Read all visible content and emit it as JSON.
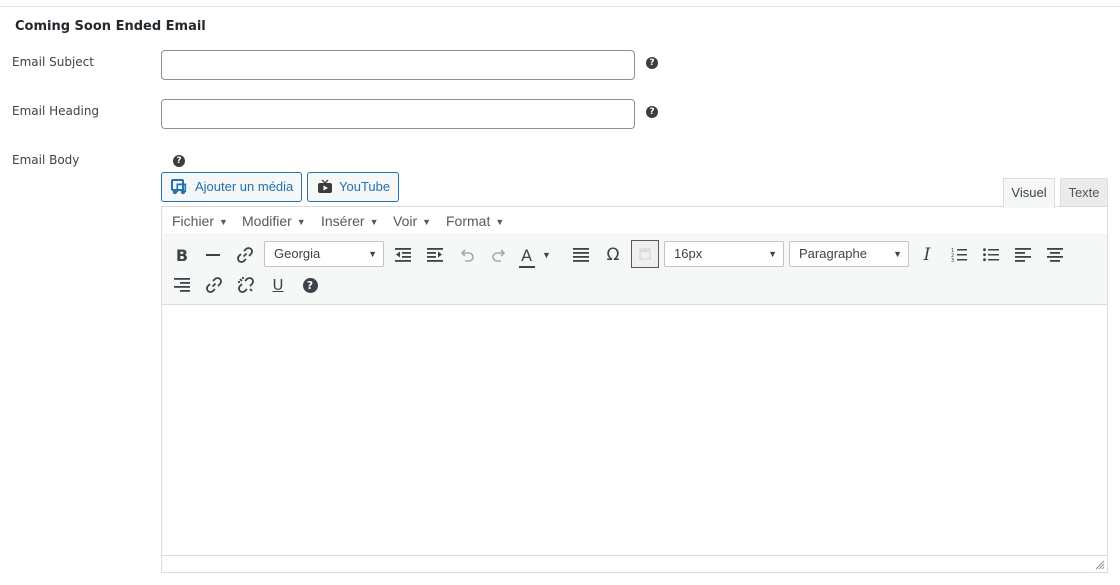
{
  "section": {
    "title": "Coming Soon Ended Email"
  },
  "fields": {
    "subject": {
      "label": "Email Subject",
      "value": "",
      "help": "?"
    },
    "heading": {
      "label": "Email Heading",
      "value": "",
      "help": "?"
    },
    "body": {
      "label": "Email Body",
      "help": "?"
    }
  },
  "media_buttons": {
    "add_media": "Ajouter un média",
    "youtube": "YouTube"
  },
  "editor_tabs": {
    "visual": "Visuel",
    "text": "Texte"
  },
  "menubar": {
    "file": "Fichier",
    "edit": "Modifier",
    "insert": "Insérer",
    "view": "Voir",
    "format": "Format"
  },
  "toolbar": {
    "font_family": "Georgia",
    "font_size": "16px",
    "block_format": "Paragraphe",
    "text_color_letter": "A",
    "omega": "Ω",
    "help": "?"
  },
  "icons": [
    "bold-icon",
    "horizontal-line-icon",
    "link-icon",
    "outdent-icon",
    "indent-icon",
    "undo-icon",
    "redo-icon",
    "text-color-icon",
    "justify-icon",
    "special-char-icon",
    "clear-formatting-icon",
    "italic-icon",
    "numbered-list-icon",
    "bullet-list-icon",
    "align-left-icon",
    "align-center-icon",
    "align-right-icon",
    "unlink-icon",
    "underline-icon",
    "help-icon",
    "resize-icon"
  ],
  "colors": {
    "link_blue": "#2271b1",
    "toolbar_bg": "#f6f7f7",
    "border": "#dcdcde",
    "icon": "#3c434a"
  }
}
